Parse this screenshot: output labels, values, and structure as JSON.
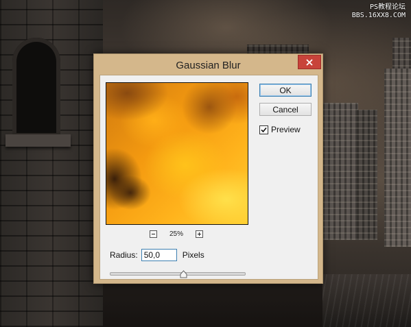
{
  "watermark": {
    "line1": "PS教程论坛",
    "line2": "BBS.16XX8.COM"
  },
  "dialog": {
    "title": "Gaussian Blur",
    "close_icon": "close-icon",
    "ok_label": "OK",
    "cancel_label": "Cancel",
    "preview_label": "Preview",
    "preview_checked": true,
    "zoom_value": "25%",
    "zoom_out_icon": "minus-icon",
    "zoom_in_icon": "plus-icon",
    "radius_label": "Radius:",
    "radius_value": "50,0",
    "radius_unit": "Pixels",
    "slider_position": 0.55
  },
  "colors": {
    "titlebar": "#d4b78b",
    "close_button": "#c8433a",
    "dialog_body": "#f0f0f0",
    "focus_border": "#3c7fb1"
  }
}
